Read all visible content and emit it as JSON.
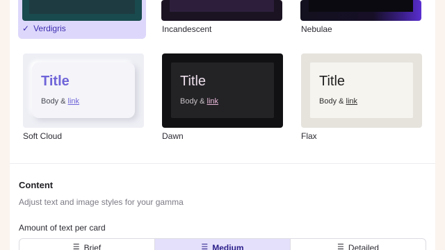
{
  "themes": {
    "row1": [
      {
        "name": "Verdigris",
        "selected": true,
        "check_icon": "checkmark-icon"
      },
      {
        "name": "Incandescent",
        "selected": false
      },
      {
        "name": "Nebulae",
        "selected": false
      }
    ],
    "row2": [
      {
        "name": "Soft Cloud",
        "preview_title": "Title",
        "preview_body": "Body & ",
        "preview_link": "link"
      },
      {
        "name": "Dawn",
        "preview_title": "Title",
        "preview_body": "Body & ",
        "preview_link": "link"
      },
      {
        "name": "Flax",
        "preview_title": "Title",
        "preview_body": "Body & ",
        "preview_link": "link"
      }
    ]
  },
  "content": {
    "title": "Content",
    "description": "Adjust text and image styles for your gamma",
    "amount_label": "Amount of text per card",
    "amount_options": [
      {
        "label": "Brief",
        "icon": "lines-brief-icon",
        "glyph": "☰",
        "active": false
      },
      {
        "label": "Medium",
        "icon": "lines-medium-icon",
        "glyph": "☰",
        "active": true
      },
      {
        "label": "Detailed",
        "icon": "lines-detailed-icon",
        "glyph": "☰",
        "active": false
      }
    ]
  },
  "colors": {
    "accent": "#3d2db0",
    "selected_bg": "#ddd8fb",
    "segment_active_bg": "#e4e0fb"
  }
}
